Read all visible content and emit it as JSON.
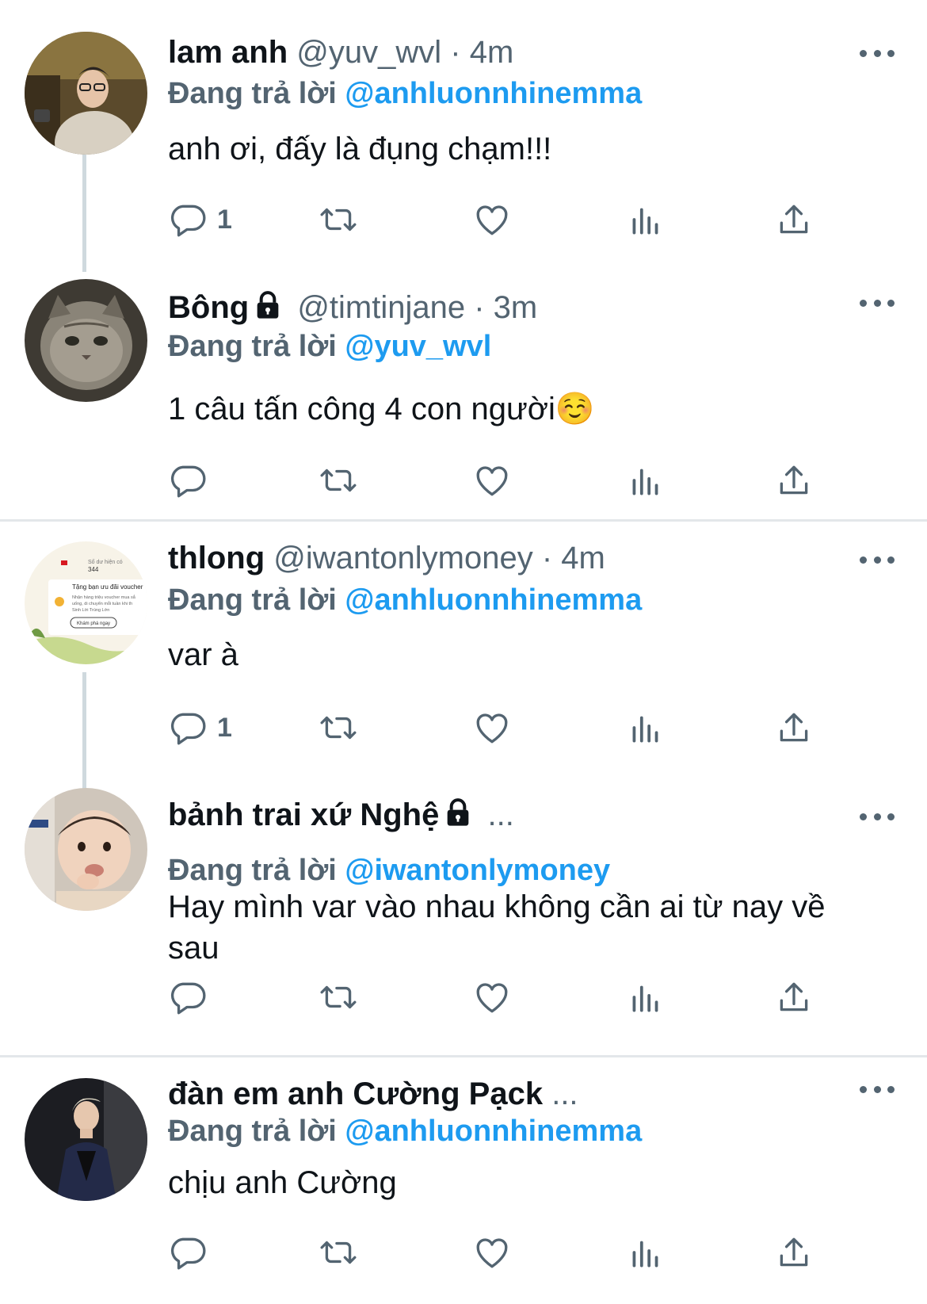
{
  "colors": {
    "accent": "#1d9bf0",
    "secondary_text": "#536471",
    "primary_text": "#0f1419",
    "divider": "#e3e7ea"
  },
  "icons": {
    "reply": "reply-icon",
    "retweet": "retweet-icon",
    "like": "heart-icon",
    "views": "views-icon",
    "share": "share-icon",
    "more": "more-icon",
    "lock": "lock-icon"
  },
  "tweets": [
    {
      "name": "lam anh",
      "handle": "@yuv_wvl",
      "time": "· 4m",
      "reply_prefix": "Đang trả lời",
      "reply_to": "@anhluonnhinemma",
      "text": "anh ơi, đấy là đụng chạm!!!",
      "reply_count": "1"
    },
    {
      "name": "Bông",
      "handle": "@timtinjane",
      "time": "· 3m",
      "reply_prefix": "Đang trả lời",
      "reply_to": "@yuv_wvl",
      "text": "1 câu tấn công 4 con người☺️",
      "reply_count": ""
    },
    {
      "name": "thlong",
      "handle": "@iwantonlymoney",
      "time": "· 4m",
      "reply_prefix": "Đang trả lời",
      "reply_to": "@anhluonnhinemma",
      "text": "var à",
      "reply_count": "1",
      "avatar_texts": [
        "Số dư hiện có",
        "344",
        "Tặng bạn ưu đãi voucher",
        "Nhận hàng triệu voucher mua sắ",
        "uống, di chuyển mỗi tuần khi th",
        "Sinh Lời Trúng Lớn",
        "Khám phá ngay"
      ]
    },
    {
      "name": "bảnh trai xứ Nghệ",
      "handle": "...",
      "time": "",
      "reply_prefix": "Đang trả lời",
      "reply_to": "@iwantonlymoney",
      "text": "Hay mình var vào nhau không cần ai từ nay về sau",
      "reply_count": ""
    },
    {
      "name": "đàn em anh Cường Pạck",
      "handle": "...",
      "time": "",
      "reply_prefix": "Đang trả lời",
      "reply_to": "@anhluonnhinemma",
      "text": "chịu anh Cường",
      "reply_count": ""
    }
  ]
}
